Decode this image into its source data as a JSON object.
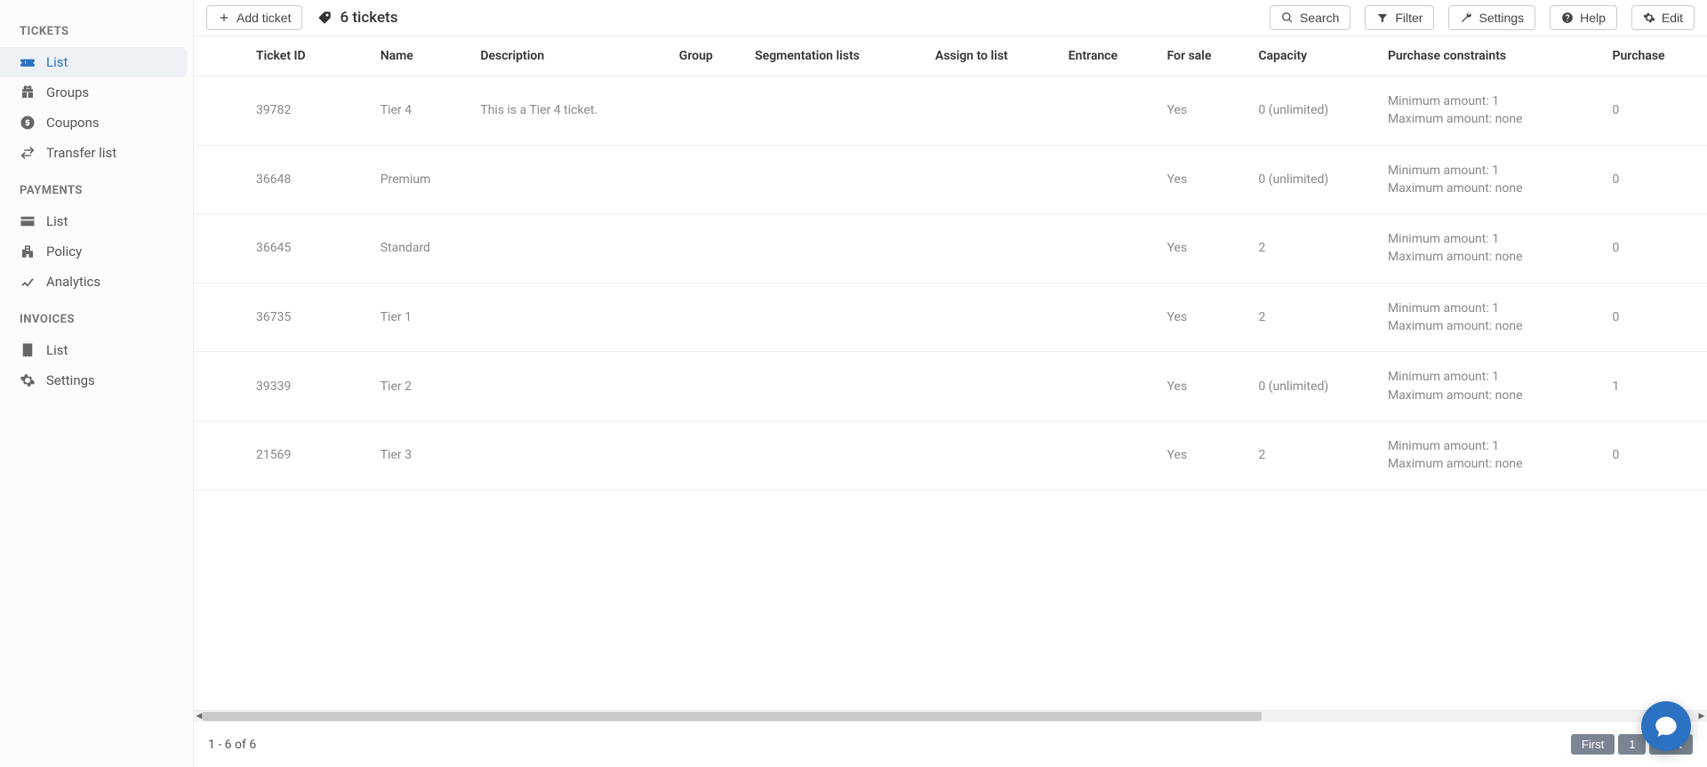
{
  "sidebar": {
    "sections": [
      {
        "title": "TICKETS",
        "items": [
          {
            "label": "List",
            "icon": "ticket-icon",
            "active": true
          },
          {
            "label": "Groups",
            "icon": "gift-icon",
            "active": false
          },
          {
            "label": "Coupons",
            "icon": "coin-icon",
            "active": false
          },
          {
            "label": "Transfer list",
            "icon": "transfer-icon",
            "active": false
          }
        ]
      },
      {
        "title": "PAYMENTS",
        "items": [
          {
            "label": "List",
            "icon": "card-icon",
            "active": false
          },
          {
            "label": "Policy",
            "icon": "building-icon",
            "active": false
          },
          {
            "label": "Analytics",
            "icon": "chart-icon",
            "active": false
          }
        ]
      },
      {
        "title": "INVOICES",
        "items": [
          {
            "label": "List",
            "icon": "receipt-icon",
            "active": false
          },
          {
            "label": "Settings",
            "icon": "gear-icon",
            "active": false
          }
        ]
      }
    ]
  },
  "toolbar": {
    "add_button": "Add ticket",
    "count_label": "6 tickets",
    "buttons": {
      "search": "Search",
      "filter": "Filter",
      "settings": "Settings",
      "help": "Help",
      "edit": "Edit"
    }
  },
  "table": {
    "columns": [
      "Ticket ID",
      "Name",
      "Description",
      "Group",
      "Segmentation lists",
      "Assign to list",
      "Entrance",
      "For sale",
      "Capacity",
      "Purchase constraints",
      "Purchase"
    ],
    "rows": [
      {
        "ticket_id": "39782",
        "name": "Tier 4",
        "description": "This is a Tier 4 ticket.",
        "group": "",
        "segmentation": "",
        "assign": "",
        "entrance": "",
        "for_sale": "Yes",
        "capacity": "0 (unlimited)",
        "constraint_min": "Minimum amount: 1",
        "constraint_max": "Maximum amount: none",
        "purchase": "0"
      },
      {
        "ticket_id": "36648",
        "name": "Premium",
        "description": "",
        "group": "",
        "segmentation": "",
        "assign": "",
        "entrance": "",
        "for_sale": "Yes",
        "capacity": "0 (unlimited)",
        "constraint_min": "Minimum amount: 1",
        "constraint_max": "Maximum amount: none",
        "purchase": "0"
      },
      {
        "ticket_id": "36645",
        "name": "Standard",
        "description": "",
        "group": "",
        "segmentation": "",
        "assign": "",
        "entrance": "",
        "for_sale": "Yes",
        "capacity": "2",
        "constraint_min": "Minimum amount: 1",
        "constraint_max": "Maximum amount: none",
        "purchase": "0"
      },
      {
        "ticket_id": "36735",
        "name": "Tier 1",
        "description": "",
        "group": "",
        "segmentation": "",
        "assign": "",
        "entrance": "",
        "for_sale": "Yes",
        "capacity": "2",
        "constraint_min": "Minimum amount: 1",
        "constraint_max": "Maximum amount: none",
        "purchase": "0"
      },
      {
        "ticket_id": "39339",
        "name": "Tier 2",
        "description": "",
        "group": "",
        "segmentation": "",
        "assign": "",
        "entrance": "",
        "for_sale": "Yes",
        "capacity": "0 (unlimited)",
        "constraint_min": "Minimum amount: 1",
        "constraint_max": "Maximum amount: none",
        "purchase": "1"
      },
      {
        "ticket_id": "21569",
        "name": "Tier 3",
        "description": "",
        "group": "",
        "segmentation": "",
        "assign": "",
        "entrance": "",
        "for_sale": "Yes",
        "capacity": "2",
        "constraint_min": "Minimum amount: 1",
        "constraint_max": "Maximum amount: none",
        "purchase": "0"
      }
    ]
  },
  "footer": {
    "range": "1 - 6 of 6"
  },
  "pager": {
    "first": "First",
    "page": "1",
    "last": "Last"
  }
}
